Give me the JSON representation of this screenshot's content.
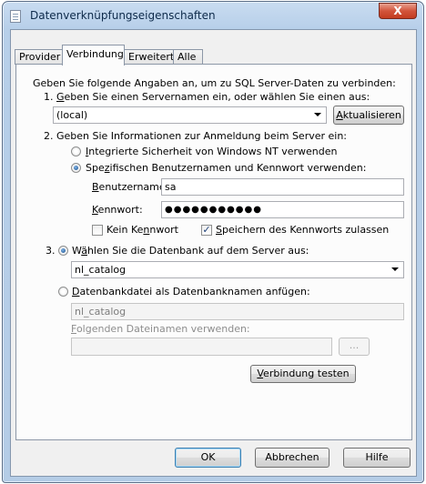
{
  "window": {
    "title": "Datenverknüpfungseigenschaften",
    "close_glyph": "X"
  },
  "tabs": [
    {
      "label": "Provider"
    },
    {
      "label": "Verbindung"
    },
    {
      "label": "Erweitert"
    },
    {
      "label": "Alle"
    }
  ],
  "intro": "Geben Sie folgende Angaben an, um zu SQL Server-Daten zu verbinden:",
  "step1": {
    "number": "1.",
    "label_pre": "",
    "label_u": "G",
    "label_post": "eben Sie einen Servernamen ein, oder wählen Sie einen aus:",
    "server_value": "(local)",
    "refresh_u": "A",
    "refresh_rest": "ktualisieren"
  },
  "step2": {
    "label": "2. Geben Sie Informationen zur Anmeldung beim Server ein:",
    "radio_integrated": {
      "u": "I",
      "rest": "ntegrierte Sicherheit von Windows NT verwenden"
    },
    "radio_specific": {
      "pre": "Spe",
      "u": "z",
      "rest": "ifischen Benutzernamen und Kennwort verwenden:"
    },
    "username_label": {
      "u": "B",
      "rest": "enutzername:"
    },
    "username_value": "sa",
    "password_label": {
      "u": "K",
      "rest": "ennwort:"
    },
    "password_value": "●●●●●●●●●●●",
    "no_password": {
      "pre": "Kein Ke",
      "u": "n",
      "rest": "nwort"
    },
    "save_password": {
      "u": "S",
      "rest": "peichern des Kennworts zulassen"
    }
  },
  "step3": {
    "number": "3.",
    "radio_db": {
      "pre": "W",
      "u": "ä",
      "rest": "hlen Sie die Datenbank auf dem Server aus:"
    },
    "database_value": "nl_catalog",
    "radio_file": {
      "u": "D",
      "rest": "atenbankdatei als Datenbanknamen anfügen:"
    },
    "file_db_value": "nl_catalog",
    "filename_label": {
      "u": "F",
      "rest": "olgenden Dateinamen verwenden:"
    },
    "filename_value": "",
    "browse_label": "...",
    "test_button": {
      "u": "V",
      "rest": "erbindung testen"
    }
  },
  "footer": {
    "ok": "OK",
    "cancel": "Abbrechen",
    "help": "Hilfe"
  },
  "state": {
    "integrated_checked": false,
    "specific_checked": true,
    "db_checked": true,
    "file_checked": false,
    "no_password_checked": false,
    "save_password_checked": true,
    "check_glyph": "✓"
  }
}
